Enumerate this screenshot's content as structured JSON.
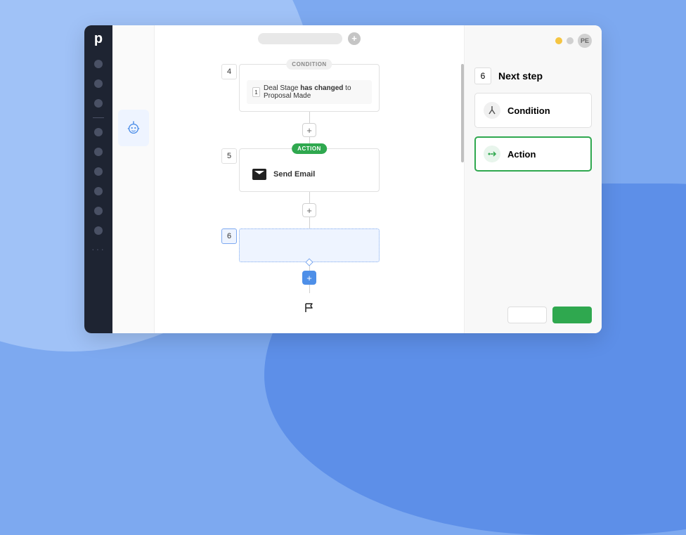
{
  "rail": {
    "logo": "p"
  },
  "topbar": {
    "plus": "+"
  },
  "flow": {
    "node4": {
      "num": "4",
      "pill": "CONDITION",
      "idx": "1",
      "text_a": "Deal Stage ",
      "text_b": "has changed",
      "text_c": " to Proposal Made"
    },
    "node5": {
      "num": "5",
      "pill": "ACTION",
      "label": "Send Email"
    },
    "node6": {
      "num": "6"
    },
    "add": "+"
  },
  "sidepanel": {
    "avatar": "PE",
    "step_num": "6",
    "title": "Next step",
    "options": {
      "condition": "Condition",
      "action": "Action"
    }
  }
}
